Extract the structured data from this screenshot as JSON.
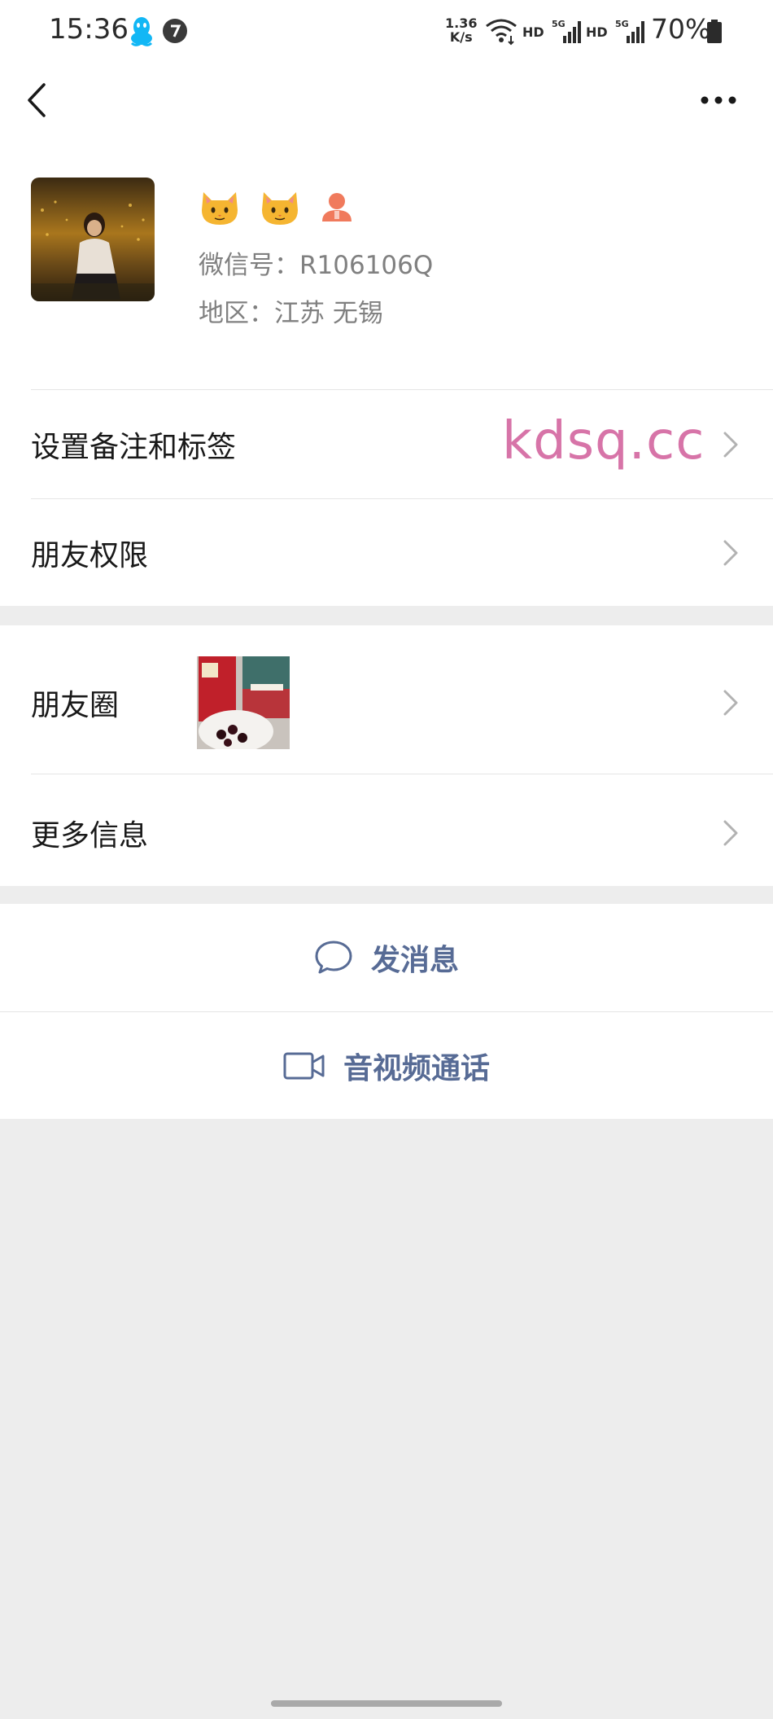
{
  "status_bar": {
    "time": "15:36",
    "net_speed_value": "1.36",
    "net_speed_unit": "K/s",
    "hd1": "HD",
    "signal1": "5G",
    "hd2": "HD",
    "signal2": "5G",
    "battery": "70%",
    "icons": [
      "qq-icon",
      "app-icon",
      "wifi-icon",
      "signal-icon",
      "battery-icon"
    ]
  },
  "nav": {
    "back_icon": "back-icon",
    "more_icon": "more-icon"
  },
  "profile": {
    "emoji": [
      "cat-face-icon",
      "cat-face-icon",
      "person-icon"
    ],
    "wechat_id": "微信号：R106106Q",
    "region": "地区：江苏 无锡"
  },
  "menu": {
    "set_remark_tags": "设置备注和标签",
    "friend_permissions": "朋友权限",
    "moments": "朋友圈",
    "more_info": "更多信息"
  },
  "watermark": "kdsq.cc",
  "actions": {
    "send_message": "发消息",
    "video_call": "音视频通话"
  },
  "colors": {
    "link_blue": "#576b95",
    "watermark_pink": "#d774a8",
    "background_gray": "#ededed"
  }
}
